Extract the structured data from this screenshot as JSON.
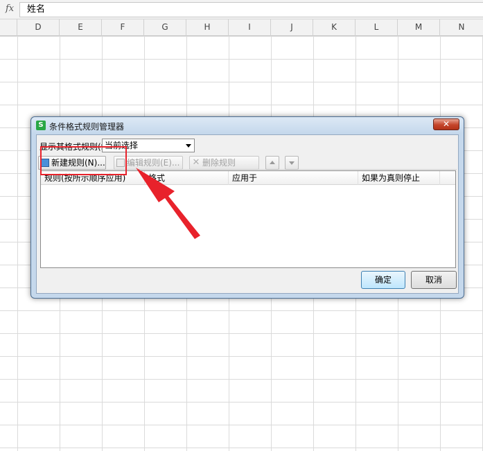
{
  "formula_bar": {
    "fx_label": "fx",
    "value": "姓名"
  },
  "columns": [
    "D",
    "E",
    "F",
    "G",
    "H",
    "I",
    "J",
    "K",
    "L",
    "M",
    "N"
  ],
  "dialog": {
    "title": "条件格式规则管理器",
    "app_icon": "S",
    "close_label": "✕",
    "show_rules_label": "显示其格式规则(S):",
    "scope_value": "当前选择",
    "toolbar": {
      "new_rule": "新建规则(N)...",
      "edit_rule": "编辑规则(E)...",
      "delete_rule": "删除规则"
    },
    "list_headers": [
      "规则(按所示顺序应用)",
      "格式",
      "应用于",
      "如果为真则停止"
    ],
    "ok": "确定",
    "cancel": "取消"
  },
  "icons": {
    "new_rule": "new-rule-icon",
    "edit_rule": "edit-rule-icon",
    "delete_rule": "delete-rule-icon",
    "move_up": "arrow-up-icon",
    "move_down": "arrow-down-icon"
  },
  "colors": {
    "annotation": "#e8222b",
    "dialog_frame": "#c5d8ec"
  }
}
